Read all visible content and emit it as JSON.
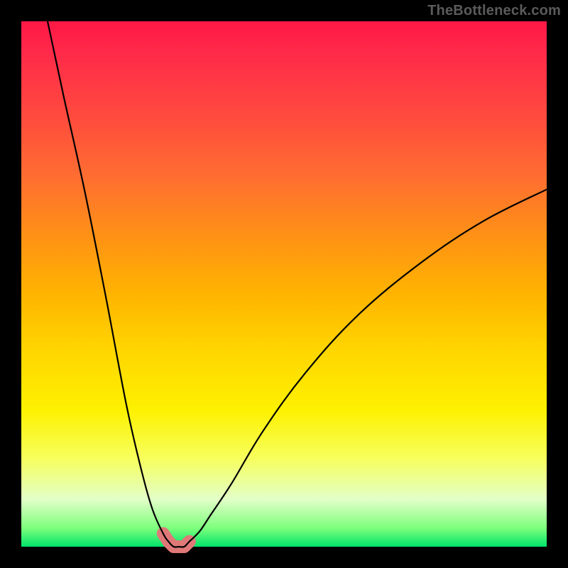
{
  "watermark": {
    "text": "TheBottleneck.com"
  },
  "colors": {
    "gradient_top": "#ff1846",
    "gradient_mid": "#ffd400",
    "gradient_bottom": "#00e36a",
    "curve_stroke": "#000000",
    "highlight_stroke": "#e07878",
    "frame": "#000000"
  },
  "chart_data": {
    "type": "line",
    "title": "",
    "xlabel": "",
    "ylabel": "",
    "xlim": [
      0,
      100
    ],
    "ylim": [
      0,
      100
    ],
    "grid": false,
    "notes": "V-shaped bottleneck curve. Minimum (≈0) occurs around x≈28–32. y rises steeply to the left (y≈100 at x≈5) and more gradually to the right (y≈68 at x=100). Pink highlight marks the flat bottom near the minimum.",
    "series": [
      {
        "name": "bottleneck-curve",
        "x": [
          5,
          8,
          12,
          16,
          20,
          23,
          25,
          27,
          28,
          29,
          30,
          31,
          32,
          34,
          36,
          40,
          46,
          54,
          64,
          76,
          88,
          100
        ],
        "y": [
          100,
          86,
          68,
          48,
          27,
          14,
          7,
          2.5,
          1,
          0,
          0,
          0,
          1,
          3,
          6,
          12,
          22,
          33,
          44,
          54,
          62,
          68
        ]
      }
    ],
    "highlight": {
      "name": "optimal-range",
      "x": [
        27,
        28,
        29,
        30,
        31,
        32
      ],
      "y": [
        2.5,
        1,
        0,
        0,
        0,
        1
      ]
    }
  }
}
